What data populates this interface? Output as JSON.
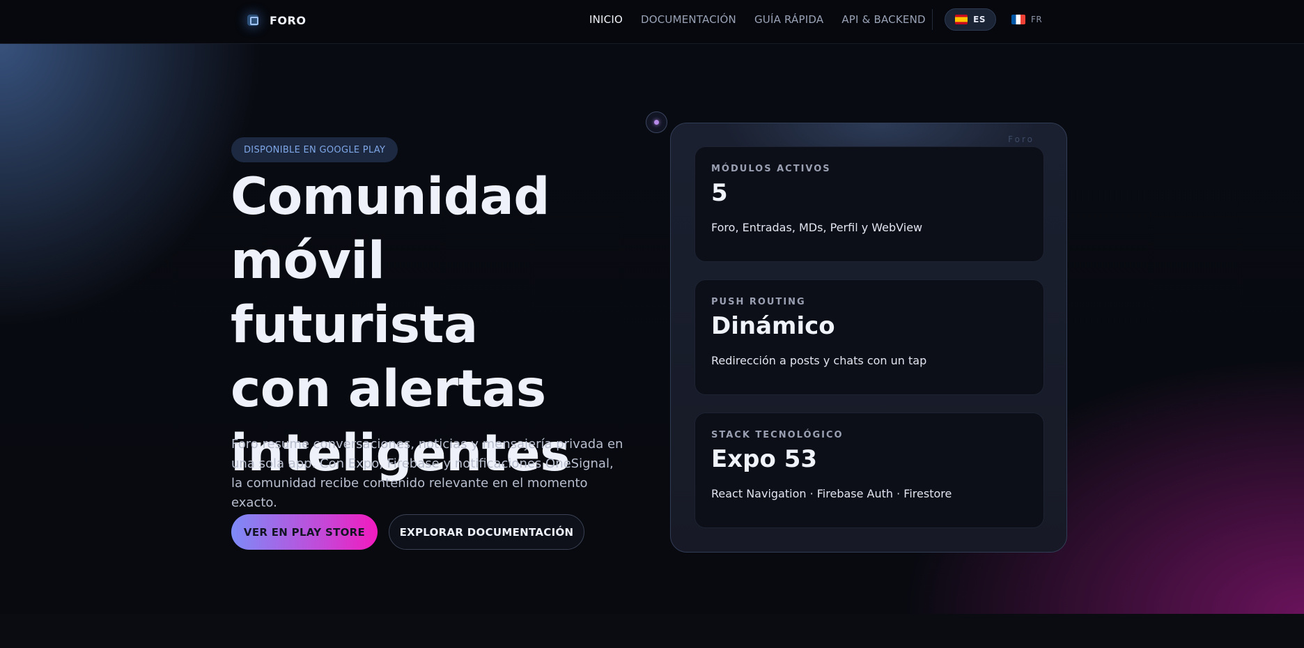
{
  "nav": {
    "brand": "FORO",
    "links": [
      "INICIO",
      "DOCUMENTACIÓN",
      "GUÍA RÁPIDA",
      "API & BACKEND"
    ],
    "languages": [
      {
        "code": "ES",
        "flag": "spain-flag-icon",
        "active": true
      },
      {
        "code": "FR",
        "flag": "france-flag-icon",
        "active": false
      }
    ]
  },
  "hero": {
    "badge": "DISPONIBLE EN GOOGLE PLAY",
    "title_lines": [
      "Comunidad",
      "móvil futurista",
      "con alertas",
      "inteligentes"
    ],
    "description": "Foro resume conversaciones, noticias y mensajería privada en una sola app. Con Expo, Firebase y notificaciones OneSignal, la comunidad recibe contenido relevante en el momento exacto.",
    "primary_button": "VER EN PLAY STORE",
    "secondary_button": "EXPLORAR DOCUMENTACIÓN"
  },
  "panel": {
    "tag": "Foro",
    "cards": [
      {
        "label": "MÓDULOS ACTIVOS",
        "value": "5",
        "desc": "Foro, Entradas, MDs, Perfil y WebView"
      },
      {
        "label": "PUSH ROUTING",
        "value": "Dinámico",
        "desc": "Redirección a posts y chats con un tap"
      },
      {
        "label": "STACK TECNOLÓGICO",
        "value": "Expo 53",
        "desc": "React Navigation · Firebase Auth · Firestore"
      }
    ]
  },
  "colors": {
    "accent_gradient_start": "#7d8bf7",
    "accent_gradient_end": "#f21bbe",
    "badge_text": "#7fa6e6",
    "background": "#0b0e16"
  }
}
